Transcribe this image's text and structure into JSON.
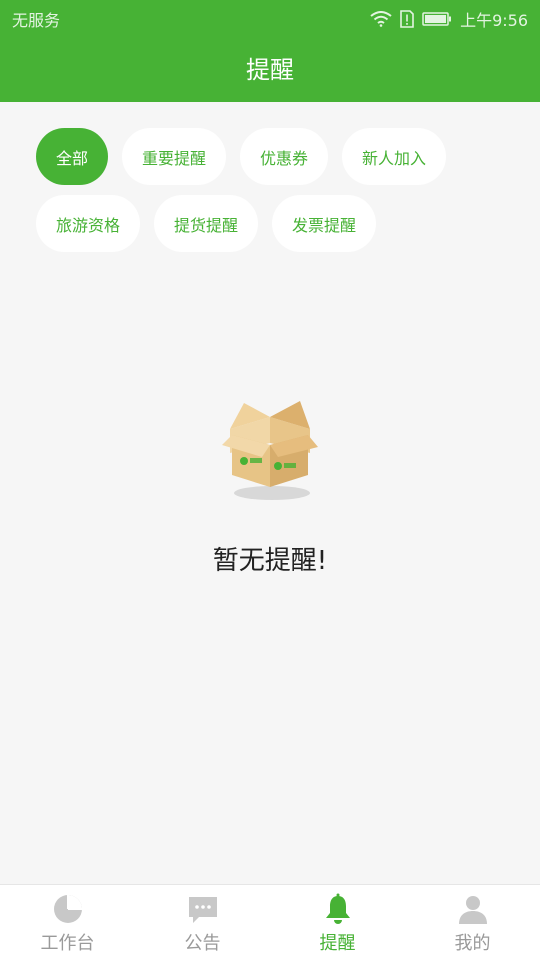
{
  "status_bar": {
    "carrier": "无服务",
    "time": "上午9:56"
  },
  "header": {
    "title": "提醒"
  },
  "filters": [
    {
      "label": "全部",
      "active": true
    },
    {
      "label": "重要提醒",
      "active": false
    },
    {
      "label": "优惠券",
      "active": false
    },
    {
      "label": "新人加入",
      "active": false
    },
    {
      "label": "旅游资格",
      "active": false
    },
    {
      "label": "提货提醒",
      "active": false
    },
    {
      "label": "发票提醒",
      "active": false
    }
  ],
  "empty_state": {
    "message": "暂无提醒!",
    "icon": "empty-box-icon"
  },
  "bottom_nav": [
    {
      "label": "工作台",
      "icon": "pie-chart-icon",
      "active": false
    },
    {
      "label": "公告",
      "icon": "chat-bubble-icon",
      "active": false
    },
    {
      "label": "提醒",
      "icon": "bell-icon",
      "active": true
    },
    {
      "label": "我的",
      "icon": "user-icon",
      "active": false
    }
  ],
  "colors": {
    "brand": "#47b235",
    "background": "#f6f6f6",
    "inactive": "#9a9a9a"
  }
}
